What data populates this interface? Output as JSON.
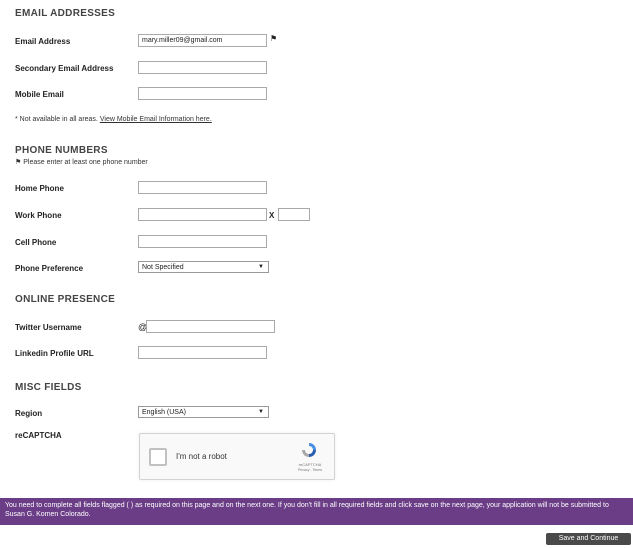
{
  "email_section": {
    "title": "EMAIL ADDRESSES",
    "email_label": "Email Address",
    "email_value": "mary.miller09@gmail.com",
    "required_flag": "⚑",
    "secondary_label": "Secondary Email Address",
    "secondary_value": "",
    "mobile_label": "Mobile Email",
    "mobile_value": "",
    "note_text": "* Not available in all areas.",
    "note_link": "View Mobile Email Information here."
  },
  "phone_section": {
    "title": "PHONE NUMBERS",
    "hint_flag": "⚑",
    "hint": "Please enter at least one phone number",
    "home_label": "Home Phone",
    "work_label": "Work Phone",
    "ext_label": "X",
    "cell_label": "Cell Phone",
    "pref_label": "Phone Preference",
    "pref_value": "Not Specified"
  },
  "online_section": {
    "title": "ONLINE PRESENCE",
    "twitter_label": "Twitter Username",
    "twitter_prefix": "@",
    "linkedin_label": "Linkedin Profile URL"
  },
  "misc_section": {
    "title": "MISC FIELDS",
    "region_label": "Region",
    "region_value": "English (USA)",
    "recaptcha_label": "reCAPTCHA",
    "captcha_text": "I'm not a robot",
    "captcha_brand": "reCAPTCHA",
    "captcha_links": "Privacy - Terms"
  },
  "banner": {
    "text": "You need to complete all fields flagged (    ) as required on this page and on the next one. If you don't fill in all required fields and click save on the next page, your application will not be submitted to Susan G. Komen Colorado."
  },
  "footer": {
    "save_button": "Save and Continue"
  },
  "colors": {
    "banner_bg": "#6b3d86",
    "button_bg": "#4a4a4a"
  },
  "icons": {
    "required": "flag-icon",
    "dropdown": "chevron-down-icon",
    "captcha": "recaptcha-logo-icon"
  }
}
